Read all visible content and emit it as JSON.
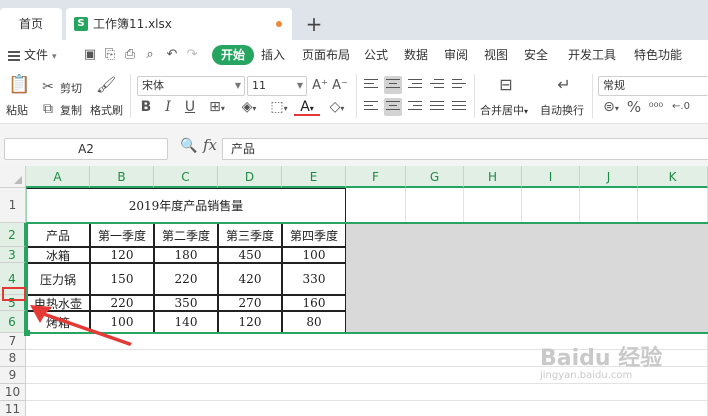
{
  "tabs": {
    "home": "首页",
    "file": "工作簿11.xlsx",
    "file_icon": "S",
    "add": "+"
  },
  "menu": {
    "file": "文件",
    "items": [
      "开始",
      "插入",
      "页面布局",
      "公式",
      "数据",
      "审阅",
      "视图",
      "安全",
      "开发工具",
      "特色功能"
    ],
    "accent": "#25a55f"
  },
  "ribbon": {
    "paste": "粘贴",
    "cut": "剪切",
    "copy": "复制",
    "format_painter": "格式刷",
    "font_name": "宋体",
    "font_size": "11",
    "merge_center": "合并居中",
    "wrap_text": "自动换行",
    "number_format": "常规",
    "bold": "B",
    "italic": "I",
    "underline": "U",
    "grow_font": "A⁺",
    "shrink_font": "A⁻"
  },
  "formula": {
    "namebox": "A2",
    "fx": "fx",
    "content": "产品"
  },
  "grid": {
    "columns": [
      "A",
      "B",
      "C",
      "D",
      "E",
      "F",
      "G",
      "H",
      "I",
      "J",
      "K"
    ],
    "rows": [
      "1",
      "2",
      "3",
      "4",
      "5",
      "6",
      "7",
      "8",
      "9",
      "10",
      "11"
    ],
    "title": "2019年度产品销售量",
    "headers": [
      "产品",
      "第一季度",
      "第二季度",
      "第三季度",
      "第四季度"
    ],
    "data": [
      [
        "冰箱",
        "120",
        "180",
        "450",
        "100"
      ],
      [
        "压力锅",
        "150",
        "220",
        "420",
        "330"
      ],
      [
        "电热水壶",
        "220",
        "350",
        "270",
        "160"
      ],
      [
        "烤箱",
        "100",
        "140",
        "120",
        "80"
      ]
    ],
    "selection_color": "#25a55f",
    "annotation_color": "#e53935"
  },
  "watermark": {
    "main": "Baidu 经验",
    "sub": "jingyan.baidu.com"
  }
}
